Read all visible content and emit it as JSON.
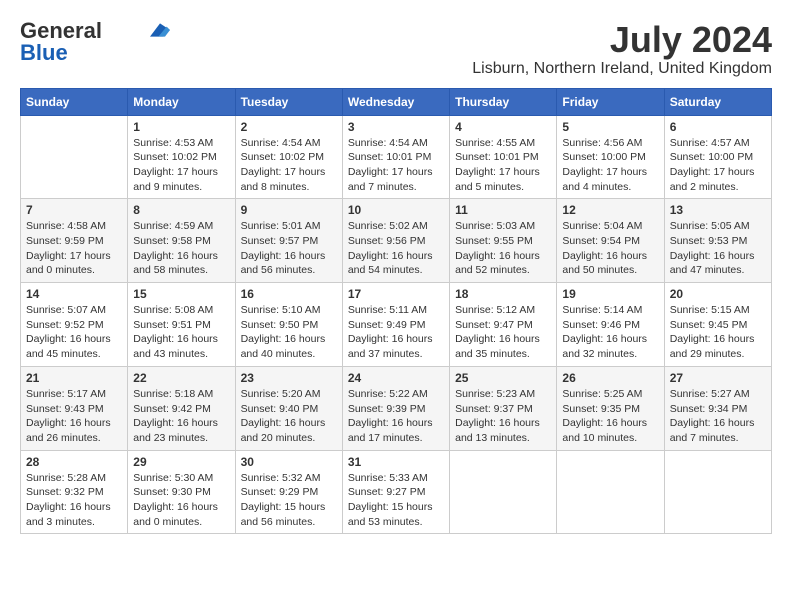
{
  "logo": {
    "general": "General",
    "blue": "Blue"
  },
  "title": "July 2024",
  "location": "Lisburn, Northern Ireland, United Kingdom",
  "headers": [
    "Sunday",
    "Monday",
    "Tuesday",
    "Wednesday",
    "Thursday",
    "Friday",
    "Saturday"
  ],
  "weeks": [
    [
      {
        "day": "",
        "info": ""
      },
      {
        "day": "1",
        "info": "Sunrise: 4:53 AM\nSunset: 10:02 PM\nDaylight: 17 hours\nand 9 minutes."
      },
      {
        "day": "2",
        "info": "Sunrise: 4:54 AM\nSunset: 10:02 PM\nDaylight: 17 hours\nand 8 minutes."
      },
      {
        "day": "3",
        "info": "Sunrise: 4:54 AM\nSunset: 10:01 PM\nDaylight: 17 hours\nand 7 minutes."
      },
      {
        "day": "4",
        "info": "Sunrise: 4:55 AM\nSunset: 10:01 PM\nDaylight: 17 hours\nand 5 minutes."
      },
      {
        "day": "5",
        "info": "Sunrise: 4:56 AM\nSunset: 10:00 PM\nDaylight: 17 hours\nand 4 minutes."
      },
      {
        "day": "6",
        "info": "Sunrise: 4:57 AM\nSunset: 10:00 PM\nDaylight: 17 hours\nand 2 minutes."
      }
    ],
    [
      {
        "day": "7",
        "info": "Sunrise: 4:58 AM\nSunset: 9:59 PM\nDaylight: 17 hours\nand 0 minutes."
      },
      {
        "day": "8",
        "info": "Sunrise: 4:59 AM\nSunset: 9:58 PM\nDaylight: 16 hours\nand 58 minutes."
      },
      {
        "day": "9",
        "info": "Sunrise: 5:01 AM\nSunset: 9:57 PM\nDaylight: 16 hours\nand 56 minutes."
      },
      {
        "day": "10",
        "info": "Sunrise: 5:02 AM\nSunset: 9:56 PM\nDaylight: 16 hours\nand 54 minutes."
      },
      {
        "day": "11",
        "info": "Sunrise: 5:03 AM\nSunset: 9:55 PM\nDaylight: 16 hours\nand 52 minutes."
      },
      {
        "day": "12",
        "info": "Sunrise: 5:04 AM\nSunset: 9:54 PM\nDaylight: 16 hours\nand 50 minutes."
      },
      {
        "day": "13",
        "info": "Sunrise: 5:05 AM\nSunset: 9:53 PM\nDaylight: 16 hours\nand 47 minutes."
      }
    ],
    [
      {
        "day": "14",
        "info": "Sunrise: 5:07 AM\nSunset: 9:52 PM\nDaylight: 16 hours\nand 45 minutes."
      },
      {
        "day": "15",
        "info": "Sunrise: 5:08 AM\nSunset: 9:51 PM\nDaylight: 16 hours\nand 43 minutes."
      },
      {
        "day": "16",
        "info": "Sunrise: 5:10 AM\nSunset: 9:50 PM\nDaylight: 16 hours\nand 40 minutes."
      },
      {
        "day": "17",
        "info": "Sunrise: 5:11 AM\nSunset: 9:49 PM\nDaylight: 16 hours\nand 37 minutes."
      },
      {
        "day": "18",
        "info": "Sunrise: 5:12 AM\nSunset: 9:47 PM\nDaylight: 16 hours\nand 35 minutes."
      },
      {
        "day": "19",
        "info": "Sunrise: 5:14 AM\nSunset: 9:46 PM\nDaylight: 16 hours\nand 32 minutes."
      },
      {
        "day": "20",
        "info": "Sunrise: 5:15 AM\nSunset: 9:45 PM\nDaylight: 16 hours\nand 29 minutes."
      }
    ],
    [
      {
        "day": "21",
        "info": "Sunrise: 5:17 AM\nSunset: 9:43 PM\nDaylight: 16 hours\nand 26 minutes."
      },
      {
        "day": "22",
        "info": "Sunrise: 5:18 AM\nSunset: 9:42 PM\nDaylight: 16 hours\nand 23 minutes."
      },
      {
        "day": "23",
        "info": "Sunrise: 5:20 AM\nSunset: 9:40 PM\nDaylight: 16 hours\nand 20 minutes."
      },
      {
        "day": "24",
        "info": "Sunrise: 5:22 AM\nSunset: 9:39 PM\nDaylight: 16 hours\nand 17 minutes."
      },
      {
        "day": "25",
        "info": "Sunrise: 5:23 AM\nSunset: 9:37 PM\nDaylight: 16 hours\nand 13 minutes."
      },
      {
        "day": "26",
        "info": "Sunrise: 5:25 AM\nSunset: 9:35 PM\nDaylight: 16 hours\nand 10 minutes."
      },
      {
        "day": "27",
        "info": "Sunrise: 5:27 AM\nSunset: 9:34 PM\nDaylight: 16 hours\nand 7 minutes."
      }
    ],
    [
      {
        "day": "28",
        "info": "Sunrise: 5:28 AM\nSunset: 9:32 PM\nDaylight: 16 hours\nand 3 minutes."
      },
      {
        "day": "29",
        "info": "Sunrise: 5:30 AM\nSunset: 9:30 PM\nDaylight: 16 hours\nand 0 minutes."
      },
      {
        "day": "30",
        "info": "Sunrise: 5:32 AM\nSunset: 9:29 PM\nDaylight: 15 hours\nand 56 minutes."
      },
      {
        "day": "31",
        "info": "Sunrise: 5:33 AM\nSunset: 9:27 PM\nDaylight: 15 hours\nand 53 minutes."
      },
      {
        "day": "",
        "info": ""
      },
      {
        "day": "",
        "info": ""
      },
      {
        "day": "",
        "info": ""
      }
    ]
  ]
}
